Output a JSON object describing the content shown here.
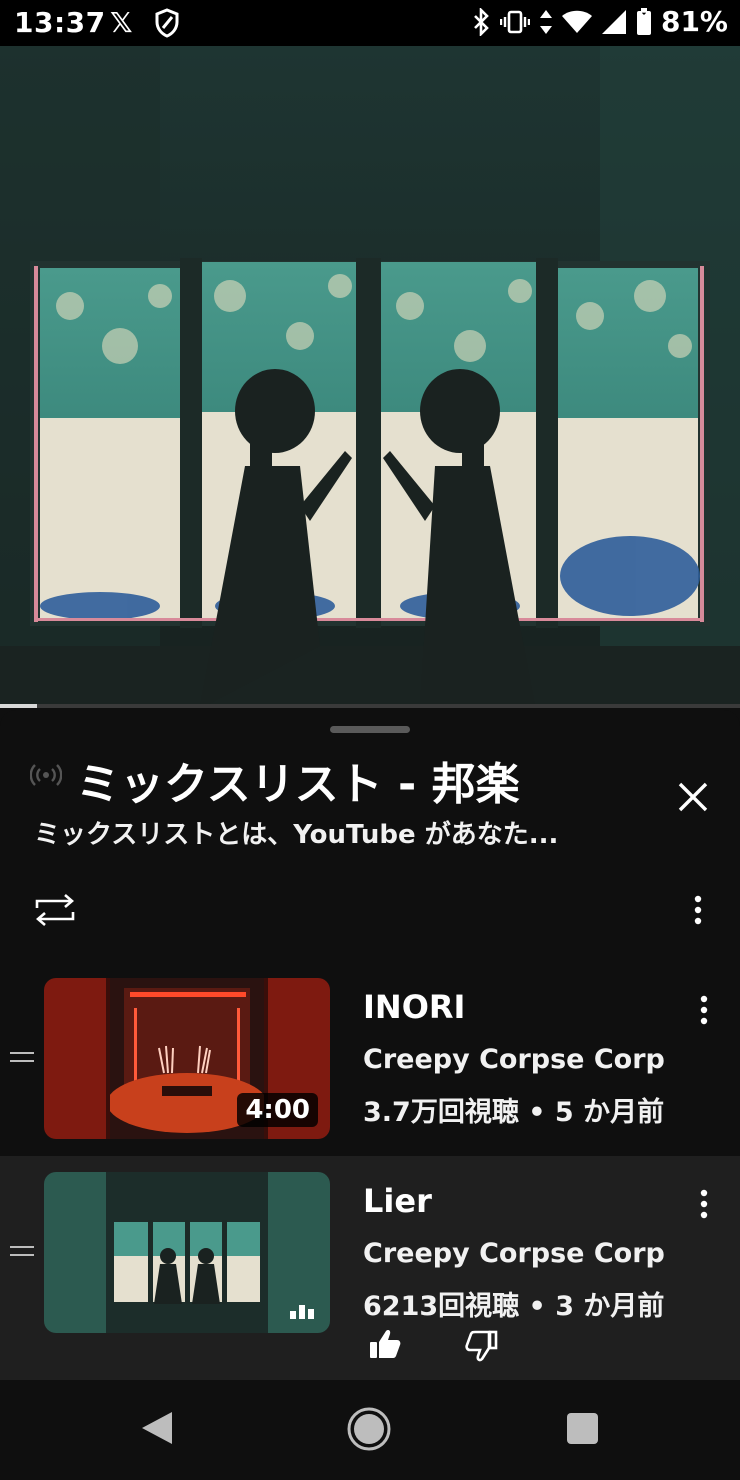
{
  "status_bar": {
    "time": "13:37",
    "x_app": "𝕏",
    "battery": "81%"
  },
  "video": {
    "progress_fraction": 0.05
  },
  "playlist": {
    "title": "ミックスリスト - 邦楽",
    "description": "ミックスリストとは、YouTube があなた..."
  },
  "items": [
    {
      "title": "INORI",
      "channel": "Creepy Corpse Corp",
      "meta": "3.7万回視聴 • 5 か月前",
      "duration": "4:00",
      "now_playing": false
    },
    {
      "title": "Lier",
      "channel": "Creepy Corpse Corp",
      "meta": "6213回視聴 • 3 か月前",
      "now_playing": true
    }
  ],
  "colors": {
    "background": "#0f0f0f",
    "active_row": "#1f1f1f",
    "video_teal": "#2f5a54"
  },
  "icons": [
    "x-logo-icon",
    "shield-icon",
    "bluetooth-icon",
    "vibrate-icon",
    "data-arrows-icon",
    "wifi-icon",
    "signal-icon",
    "battery-icon",
    "live-broadcast-icon",
    "close-icon",
    "repeat-icon",
    "more-vert-icon",
    "drag-handle-icon",
    "now-playing-bars-icon",
    "thumb-up-icon",
    "thumb-down-icon",
    "back-icon",
    "home-icon",
    "recents-icon"
  ]
}
